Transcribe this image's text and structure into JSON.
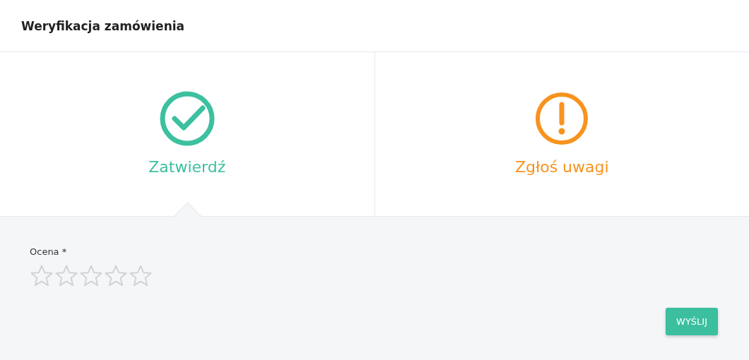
{
  "title": "Weryfikacja zamówienia",
  "options": [
    {
      "label": "Zatwierdź",
      "kind": "approve",
      "selected": true
    },
    {
      "label": "Zgłoś uwagi",
      "kind": "report",
      "selected": false
    }
  ],
  "rating": {
    "label": "Ocena *",
    "stars": 0
  },
  "submit_button": "WYŚLIJ"
}
